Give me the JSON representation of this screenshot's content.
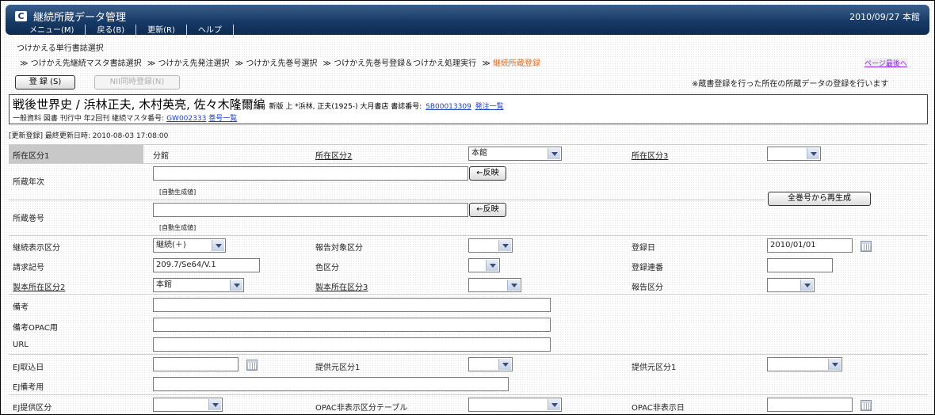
{
  "app": {
    "logo": "C",
    "title": "継続所蔵データ管理",
    "date": "2010/09/27 本館"
  },
  "menu": {
    "items": [
      "メニュー(M)",
      "戻る(B)",
      "更新(R)",
      "ヘルプ"
    ]
  },
  "page": {
    "section_title": "つけかえる単行書誌選択",
    "breadcrumb": {
      "sep": "≫",
      "items": [
        "つけかえ先継続マスタ書誌選択",
        "つけかえ先発注選択",
        "つけかえ先巻号選択",
        "つけかえ先巻号登録＆つけかえ処理実行"
      ],
      "current": "継続所蔵登録"
    },
    "page_last_link": "ページ最後へ",
    "register_button": "登 録 (S)",
    "nii_button": "NII同時登録(N)",
    "notice": "※蔵書登録を行った所在の所蔵データの登録を行います"
  },
  "bib": {
    "title": "戦後世界史 / 浜林正夫, 木村英亮, 佐々木隆爾編",
    "sub": "新版 上 *浜林, 正夫(1925-) 大月書店 書誌番号:",
    "bib_no": "SB00013309",
    "order_link": "発注一覧",
    "line2": "一般資料 図書 刊行中 年2回刊 継続マスタ番号:",
    "master_no": "GW002333",
    "volume_link": "巻号一覧"
  },
  "update_info": "[更新登録]  最終更新日時: 2010-08-03 17:08:00",
  "form": {
    "location1_label": "所在区分1",
    "location1_value": "分館",
    "location2_label": "所在区分2",
    "location2_value": "本館",
    "location3_label": "所在区分3",
    "year_label": "所蔵年次",
    "reflect_btn": "←反映",
    "auto_gen": "[自動生成値]",
    "volume_label": "所蔵巻号",
    "regen_btn": "全巻号から再生成",
    "display_label": "継続表示区分",
    "display_value": "継続(＋)",
    "report_target_label": "報告対象区分",
    "reg_date_label": "登録日",
    "reg_date_value": "2010/01/01",
    "call_no_label": "請求記号",
    "call_no_value": "209.7/Se64/V.1",
    "color_label": "色区分",
    "reg_serial_label": "登録連番",
    "bind_loc2_label": "製本所在区分2",
    "bind_loc2_value": "本館",
    "bind_loc3_label": "製本所在区分3",
    "report_label": "報告区分",
    "note_label": "備考",
    "note_opac_label": "備考OPAC用",
    "url_label": "URL",
    "ej_date_label": "EJ取込日",
    "provider1_label": "提供元区分1",
    "provider1b_label": "提供元区分1",
    "ej_note_label": "EJ備考用",
    "ej_provide_label": "EJ提供区分",
    "opac_hide_table_label": "OPAC非表示区分テーブル",
    "opac_hide_date_label": "OPAC非表示日"
  }
}
